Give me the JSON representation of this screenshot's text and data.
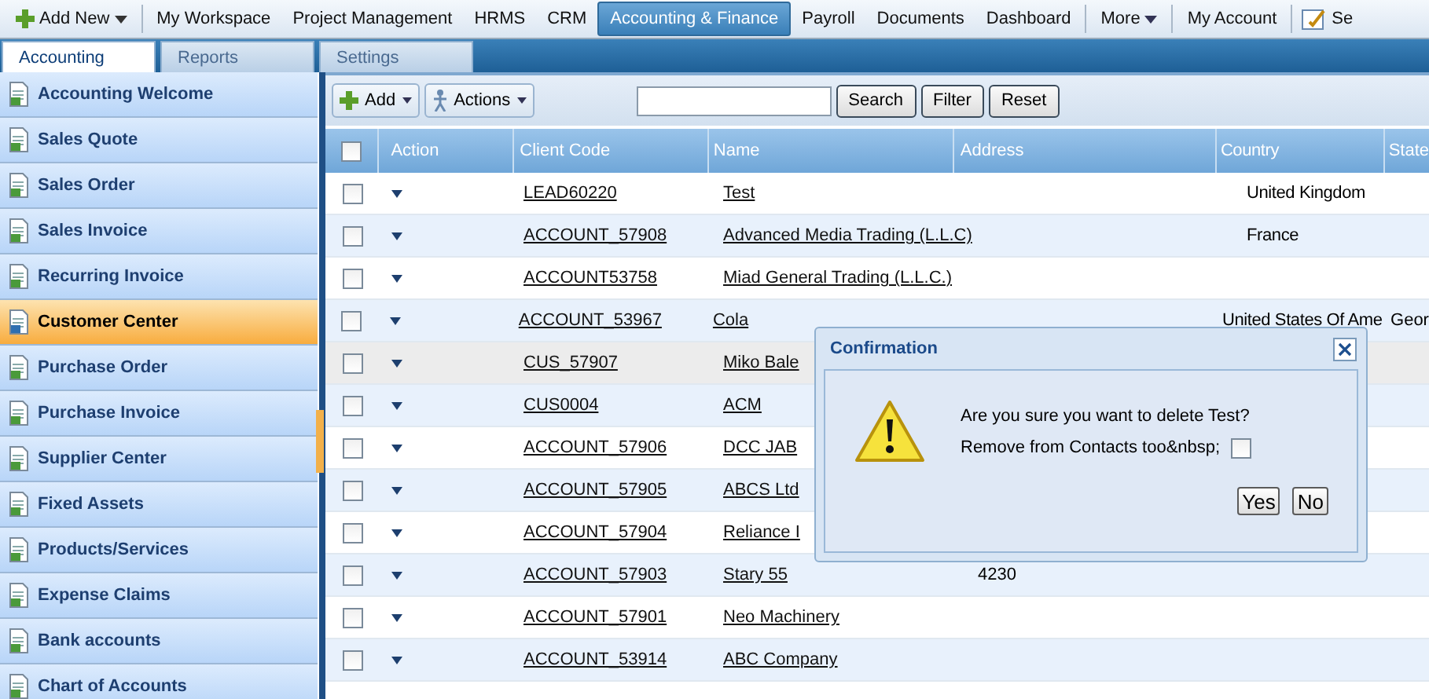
{
  "top_nav": {
    "add_new": "Add New",
    "items": [
      {
        "label": "My Workspace",
        "selected": false
      },
      {
        "label": "Project Management",
        "selected": false
      },
      {
        "label": "HRMS",
        "selected": false
      },
      {
        "label": "CRM",
        "selected": false
      },
      {
        "label": "Accounting & Finance",
        "selected": true
      },
      {
        "label": "Payroll",
        "selected": false
      },
      {
        "label": "Documents",
        "selected": false
      },
      {
        "label": "Dashboard",
        "selected": false
      }
    ],
    "more": "More",
    "account": "My Account",
    "extra": "Se"
  },
  "sub_tabs": [
    {
      "label": "Accounting",
      "selected": true
    },
    {
      "label": "Reports",
      "selected": false
    },
    {
      "label": "Settings",
      "selected": false
    }
  ],
  "sidebar": {
    "items": [
      {
        "label": "Accounting Welcome",
        "selected": false
      },
      {
        "label": "Sales Quote",
        "selected": false
      },
      {
        "label": "Sales Order",
        "selected": false
      },
      {
        "label": "Sales Invoice",
        "selected": false
      },
      {
        "label": "Recurring Invoice",
        "selected": false
      },
      {
        "label": "Customer Center",
        "selected": true
      },
      {
        "label": "Purchase Order",
        "selected": false
      },
      {
        "label": "Purchase Invoice",
        "selected": false
      },
      {
        "label": "Supplier Center",
        "selected": false
      },
      {
        "label": "Fixed Assets",
        "selected": false
      },
      {
        "label": "Products/Services",
        "selected": false
      },
      {
        "label": "Expense Claims",
        "selected": false
      },
      {
        "label": "Bank accounts",
        "selected": false
      },
      {
        "label": "Chart of Accounts",
        "selected": false
      }
    ]
  },
  "toolbar": {
    "add": "Add",
    "actions": "Actions",
    "search_button": "Search",
    "filter_button": "Filter",
    "reset_button": "Reset"
  },
  "table": {
    "header_checked": false,
    "columns": [
      "Action",
      "Client Code",
      "Name",
      "Address",
      "Country",
      "State"
    ],
    "rows": [
      {
        "checked": false,
        "highlighted": false,
        "code": "LEAD60220",
        "name": "Test",
        "address": "",
        "country": "United Kingdom",
        "state": ""
      },
      {
        "checked": false,
        "highlighted": false,
        "code": "ACCOUNT_57908",
        "name": "Advanced Media Trading (L.L.C)",
        "address": "",
        "country": "France",
        "state": ""
      },
      {
        "checked": false,
        "highlighted": false,
        "code": "ACCOUNT53758",
        "name": "Miad General Trading (L.L.C.)",
        "address": "",
        "country": "",
        "state": ""
      },
      {
        "checked": false,
        "highlighted": false,
        "code": "ACCOUNT_53967",
        "name": "Cola",
        "address": "",
        "country": "United States Of Ame",
        "state": "Geor"
      },
      {
        "checked": false,
        "highlighted": true,
        "code": "CUS_57907",
        "name": "Miko Bale",
        "address": "",
        "country": "",
        "state": ""
      },
      {
        "checked": false,
        "highlighted": false,
        "code": "CUS0004",
        "name": "ACM",
        "address": "",
        "country": "",
        "state": ""
      },
      {
        "checked": false,
        "highlighted": false,
        "code": "ACCOUNT_57906",
        "name": "DCC JAB",
        "address": "",
        "country": "",
        "state": ""
      },
      {
        "checked": false,
        "highlighted": false,
        "code": "ACCOUNT_57905",
        "name": "ABCS Ltd",
        "address": "",
        "country": "",
        "state": ""
      },
      {
        "checked": false,
        "highlighted": false,
        "code": "ACCOUNT_57904",
        "name": "Reliance I",
        "address": "",
        "country": "",
        "state": ""
      },
      {
        "checked": false,
        "highlighted": false,
        "code": "ACCOUNT_57903",
        "name": "Stary 55",
        "address": "4230",
        "country": "",
        "state": ""
      },
      {
        "checked": false,
        "highlighted": false,
        "code": "ACCOUNT_57901",
        "name": "Neo Machinery",
        "address": "",
        "country": "",
        "state": ""
      },
      {
        "checked": false,
        "highlighted": false,
        "code": "ACCOUNT_53914",
        "name": "ABC Company",
        "address": "",
        "country": "",
        "state": ""
      }
    ]
  },
  "dialog": {
    "title": "Confirmation",
    "message": "Are you sure you want to delete Test?",
    "option_label": "Remove from Contacts too&nbsp;",
    "option_checked": false,
    "yes": "Yes",
    "no": "No"
  }
}
